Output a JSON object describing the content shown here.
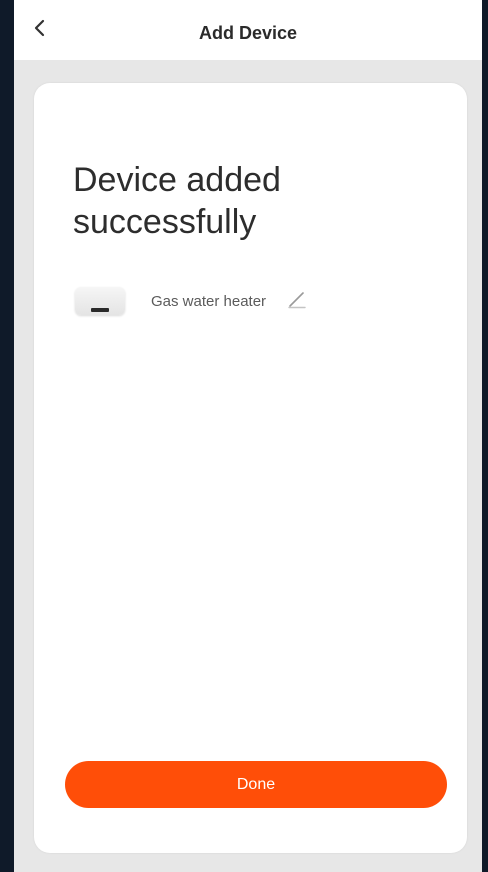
{
  "nav": {
    "title": "Add Device",
    "back_icon": "chevron-left-icon"
  },
  "main": {
    "headline": "Device added\nsuccessfully",
    "device": {
      "name": "Gas water heater",
      "thumbnail": "water-heater-device-image",
      "edit_icon": "pencil-icon"
    },
    "done_label": "Done"
  },
  "colors": {
    "accent": "#ff4e08",
    "page_background": "#e7e7e7",
    "outer_background": "#0f1a29"
  }
}
